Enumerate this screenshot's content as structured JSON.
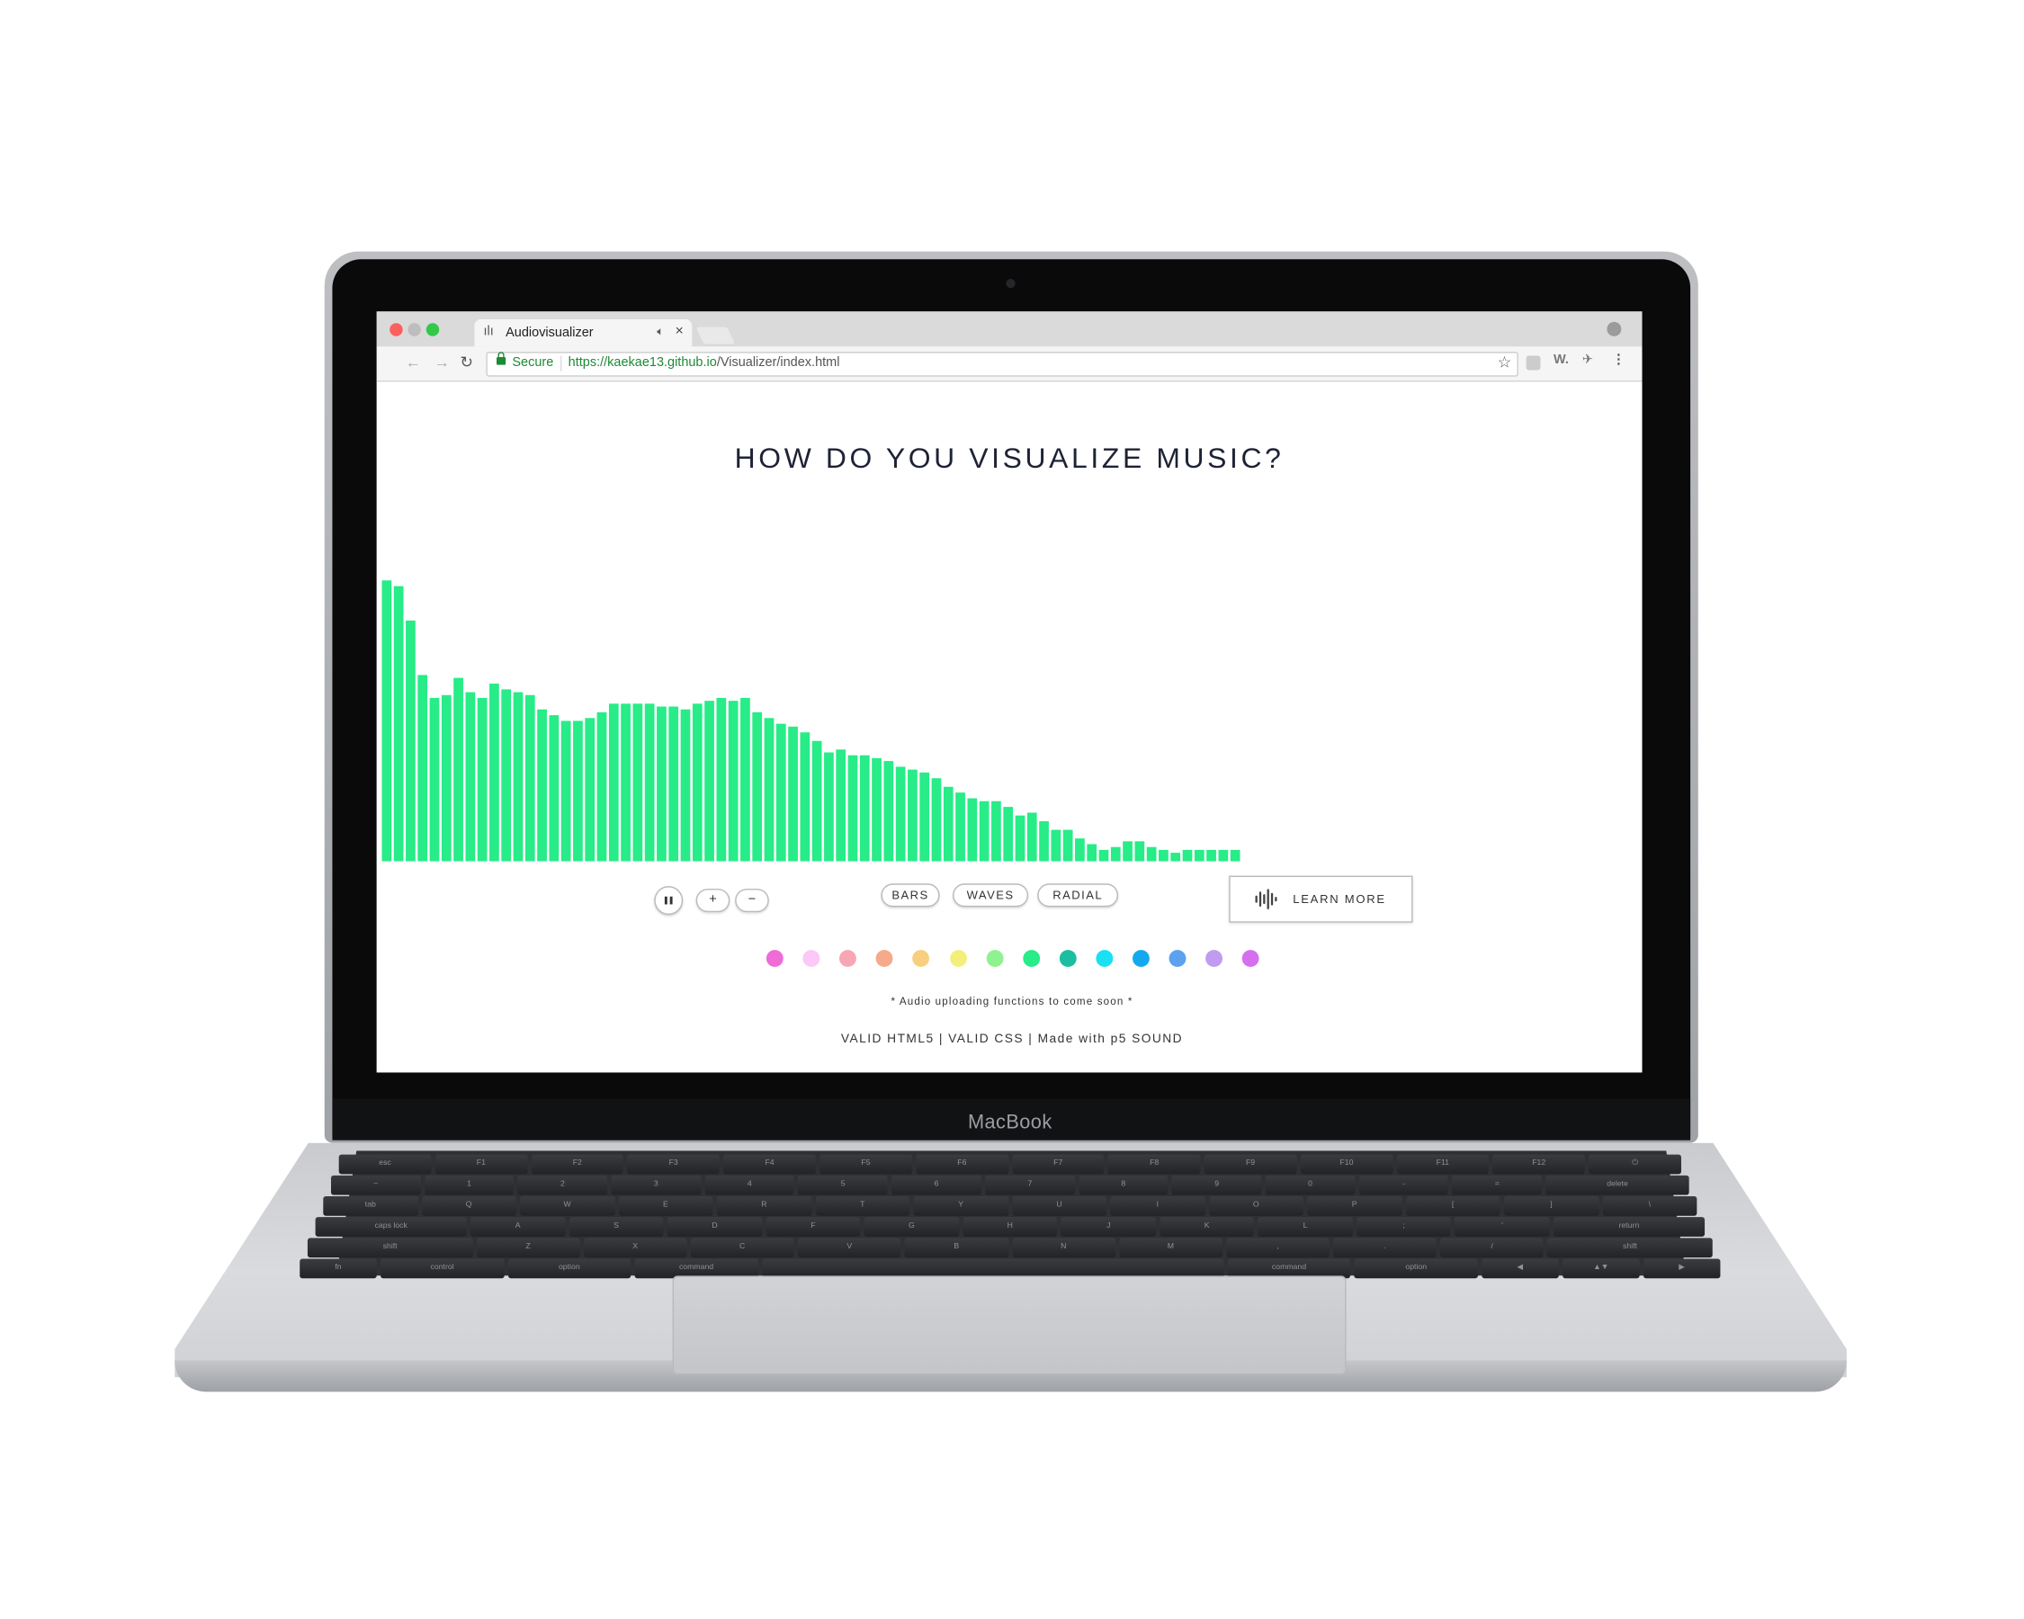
{
  "device": {
    "label": "MacBook"
  },
  "browser": {
    "tab_title": "Audiovisualizer",
    "secure_label": "Secure",
    "url_host": "https://kaekae13.github.io",
    "url_path": "/Visualizer/index.html",
    "ext_label": "W."
  },
  "page": {
    "headline": "HOW DO YOU VISUALIZE MUSIC?",
    "modes": [
      "BARS",
      "WAVES",
      "RADIAL"
    ],
    "plus_label": "+",
    "minus_label": "−",
    "learn_more_label": "LEARN MORE",
    "note": "* Audio uploading functions to come soon *",
    "footer": "VALID HTML5 | VALID CSS | Made with p5 SOUND",
    "swatches": [
      "#f06ad8",
      "#fbc8f7",
      "#f7a7b4",
      "#f5aa8a",
      "#f8cf7e",
      "#f3ef7b",
      "#8ff290",
      "#27ec87",
      "#1bbf9f",
      "#19e1f2",
      "#14a9ee",
      "#5ba1f0",
      "#bf9cf0",
      "#d56ff0"
    ]
  },
  "visualizer": {
    "bar_color": "#27ec87",
    "levels": [
      0.98,
      0.96,
      0.84,
      0.65,
      0.57,
      0.58,
      0.64,
      0.59,
      0.57,
      0.62,
      0.6,
      0.59,
      0.58,
      0.53,
      0.51,
      0.49,
      0.49,
      0.5,
      0.52,
      0.55,
      0.55,
      0.55,
      0.55,
      0.54,
      0.54,
      0.53,
      0.55,
      0.56,
      0.57,
      0.56,
      0.57,
      0.52,
      0.5,
      0.48,
      0.47,
      0.45,
      0.42,
      0.38,
      0.39,
      0.37,
      0.37,
      0.36,
      0.35,
      0.33,
      0.32,
      0.31,
      0.29,
      0.26,
      0.24,
      0.22,
      0.21,
      0.21,
      0.19,
      0.16,
      0.17,
      0.14,
      0.11,
      0.11,
      0.08,
      0.06,
      0.04,
      0.05,
      0.07,
      0.07,
      0.05,
      0.04,
      0.03,
      0.04,
      0.04,
      0.04,
      0.04,
      0.04
    ]
  },
  "keyboard": {
    "rows": [
      [
        "esc",
        "F1",
        "F2",
        "F3",
        "F4",
        "F5",
        "F6",
        "F7",
        "F8",
        "F9",
        "F10",
        "F11",
        "F12",
        "⏻"
      ],
      [
        "~",
        "1",
        "2",
        "3",
        "4",
        "5",
        "6",
        "7",
        "8",
        "9",
        "0",
        "-",
        "=",
        "delete"
      ],
      [
        "tab",
        "Q",
        "W",
        "E",
        "R",
        "T",
        "Y",
        "U",
        "I",
        "O",
        "P",
        "[",
        "]",
        "\\"
      ],
      [
        "caps lock",
        "A",
        "S",
        "D",
        "F",
        "G",
        "H",
        "J",
        "K",
        "L",
        ";",
        "'",
        "return"
      ],
      [
        "shift",
        "Z",
        "X",
        "C",
        "V",
        "B",
        "N",
        "M",
        ",",
        ".",
        "/",
        "shift"
      ],
      [
        "fn",
        "control",
        "option",
        "command",
        "",
        "command",
        "option",
        "◀",
        "▲▼",
        "▶"
      ]
    ]
  }
}
